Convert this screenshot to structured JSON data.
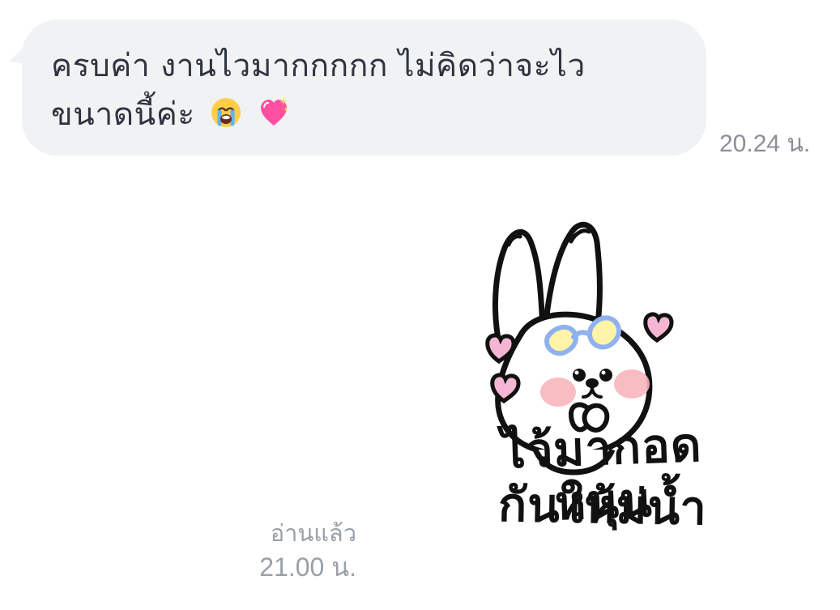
{
  "incoming_message": {
    "text": "ครบค่า งานไวมากกกกก ไม่คิดว่าจะไว ขนาดนี้ค่ะ",
    "emojis": [
      "loudly-crying-face",
      "sparkling-heart"
    ],
    "time": "20.24 น."
  },
  "outgoing_message": {
    "sticker_name": "bunny-sticker",
    "sticker_text_line1": "ไว้มากอดหนุน",
    "sticker_text_line2": "กันให้ม่น้ำ",
    "read_status": "อ่านแล้ว",
    "time": "21.00 น."
  },
  "colors": {
    "incoming_bubble": "#f1f2f4",
    "incoming_text": "#2f3440",
    "meta_text": "#8a8f98",
    "heart_pink": "#f5b6d3",
    "blush": "#f7b6bb",
    "glasses_blue": "#8fb2ef",
    "glasses_yellow": "#fff4a8"
  }
}
